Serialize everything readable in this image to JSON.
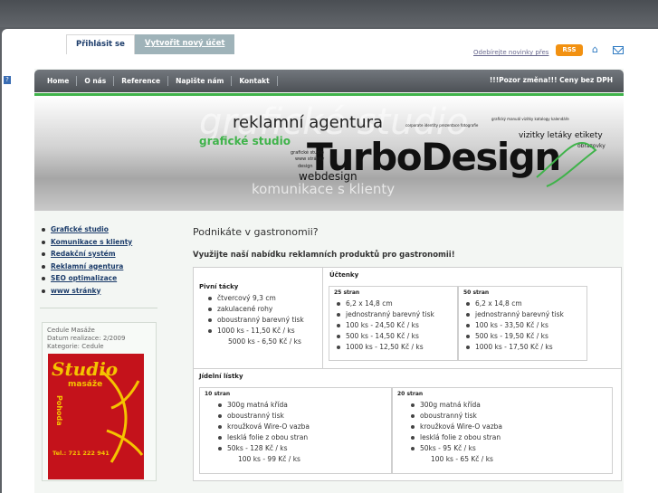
{
  "top": {
    "login_tab": "Přihlásit se",
    "register_tab": "Vytvořit nový účet",
    "newsletter_link": "Odebírejte novinky přes",
    "rss_label": "RSS"
  },
  "nav": {
    "items": [
      "Home",
      "O nás",
      "Reference",
      "Napište nám",
      "Kontakt"
    ],
    "notice": "!!!Pozor změna!!! Ceny bez DPH"
  },
  "banner": {
    "line1": "reklamní agentura",
    "brand": "TurboDesign",
    "tag_grafika": "grafické studio",
    "tag_webdesign": "webdesign",
    "tag_komunikace": "komunikace s klienty",
    "tag_vizitky": "vizitky letáky etikety",
    "tag_obrazovky": "obrazovky",
    "tag_small1": "grafický manuál vizitky katalogy kalendáře",
    "tag_small2": "corporate identity prezentace fotografie",
    "tag_small3": "www stránky",
    "tag_design": "design",
    "tag_grafika_small": "grafické studio"
  },
  "sidebar": {
    "items": [
      "Grafické studio",
      "Komunikace s klienty",
      "Redakční systém",
      "Reklamní agentura",
      "SEO optimalizace",
      "www stránky"
    ],
    "ref_title": "Cedule Masáže",
    "ref_date": "Datum realizace: 2/2009",
    "ref_category": "Kategorie: Cedule",
    "ref_img_text1": "Studio",
    "ref_img_text2": "masáže",
    "ref_img_text3": "Pohoda",
    "ref_img_phone": "Tel.: 721 222 941"
  },
  "content": {
    "title": "Podnikáte v gastronomii?",
    "subtitle": "Využijte naší nabídku reklamních produktů pro gastronomii!",
    "pivni": {
      "head": "Pivní tácky",
      "items": [
        "čtvercový 9,3 cm",
        "zakulacené rohy",
        "oboustranný barevný tisk",
        "1000 ks - 11,50 Kč / ks"
      ],
      "extra": "5000 ks - 6,50 Kč / ks"
    },
    "uctenky": {
      "head": "Účtenky",
      "a": {
        "head": "25 stran",
        "items": [
          "6,2 x 14,8 cm",
          "jednostranný barevný tisk",
          "100 ks - 24,50 Kč / ks",
          "500 ks - 14,50 Kč / ks",
          "1000 ks - 12,50 Kč / ks"
        ]
      },
      "b": {
        "head": "50 stran",
        "items": [
          "6,2 x 14,8 cm",
          "jednostranný barevný tisk",
          "100 ks - 33,50 Kč / ks",
          "500 ks - 19,50 Kč / ks",
          "1000 ks - 17,50 Kč / ks"
        ]
      }
    },
    "listky": {
      "head": "Jídelní lístky",
      "a": {
        "head": "10 stran",
        "items": [
          "300g matná křída",
          "oboustranný tisk",
          "kroužková Wire-O vazba",
          "lesklá folie z obou stran",
          "50ks - 128 Kč / ks"
        ],
        "extra": "100 ks - 99 Kč / ks"
      },
      "b": {
        "head": "20 stran",
        "items": [
          "300g matná křída",
          "oboustranný tisk",
          "kroužková Wire-O vazba",
          "lesklá folie z obou stran",
          "50ks - 95 Kč / ks"
        ],
        "extra": "100 ks - 65 Kč / ks"
      }
    }
  },
  "colors": {
    "accent_green": "#3fb34a",
    "nav_bg": "#5f6369",
    "link_blue": "#1d3d6b",
    "rss_orange": "#f29111"
  }
}
